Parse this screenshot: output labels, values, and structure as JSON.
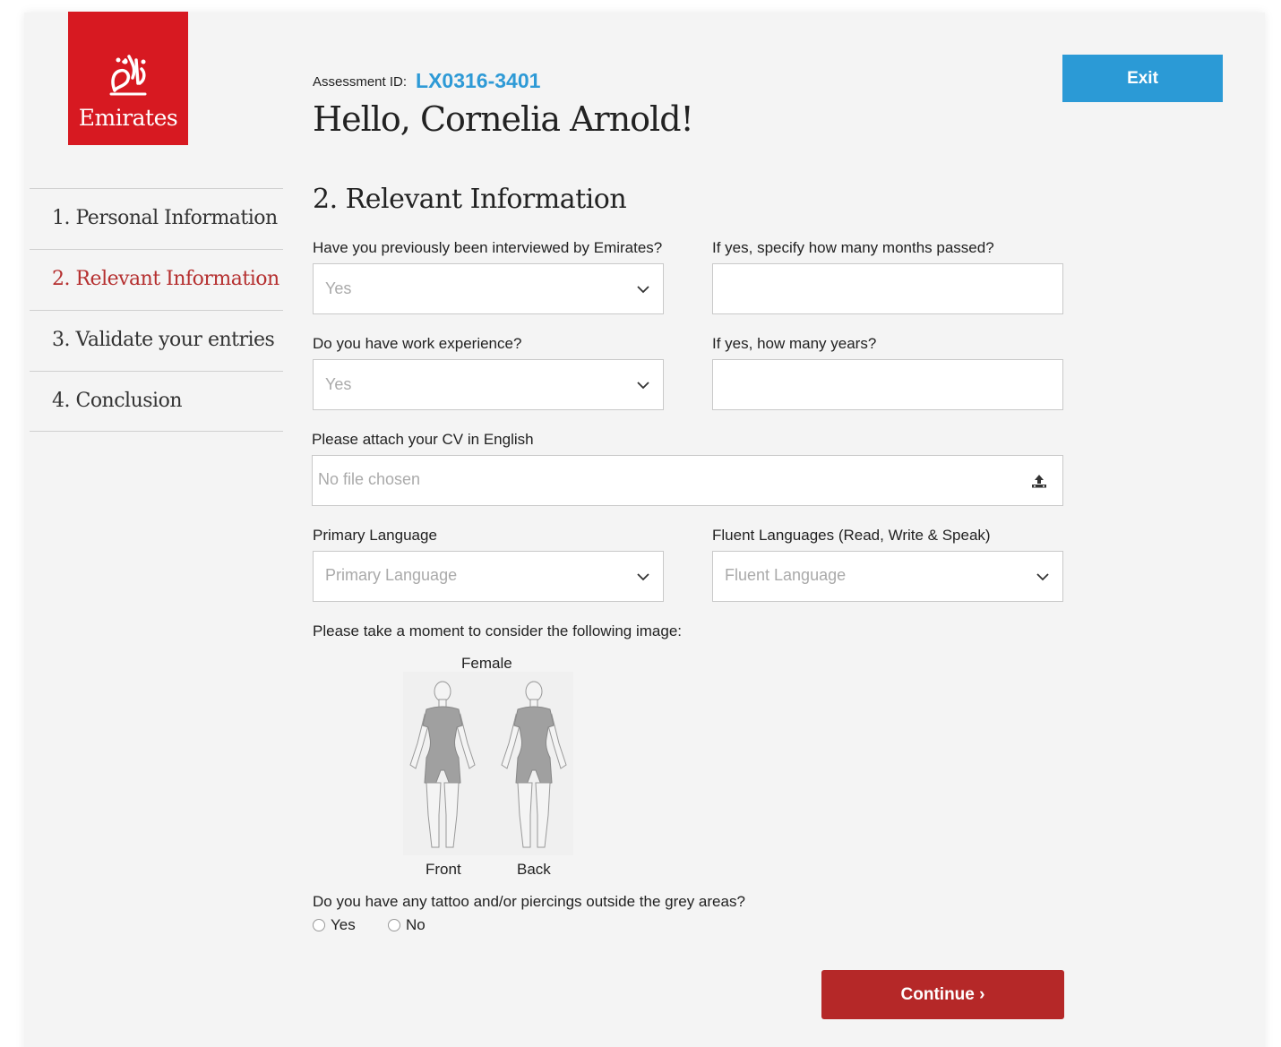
{
  "brand": {
    "wordmark": "Emirates",
    "red": "#d71921"
  },
  "header": {
    "assessment_label": "Assessment ID:",
    "assessment_id": "LX0316-3401",
    "greeting": "Hello, Cornelia Arnold!",
    "exit_label": "Exit"
  },
  "steps": [
    {
      "label": "1. Personal Information",
      "active": false
    },
    {
      "label": "2. Relevant Information",
      "active": true
    },
    {
      "label": "3. Validate your entries",
      "active": false
    },
    {
      "label": "4. Conclusion",
      "active": false
    }
  ],
  "form": {
    "title": "2. Relevant Information",
    "interviewed": {
      "label": "Have you previously been interviewed by Emirates?",
      "value": "Yes"
    },
    "months_passed": {
      "label": "If yes, specify how many months passed?",
      "value": ""
    },
    "work_experience": {
      "label": "Do you have work experience?",
      "value": "Yes"
    },
    "years": {
      "label": "If yes, how many years?",
      "value": ""
    },
    "cv": {
      "label": "Please attach your CV in English",
      "value": "No file chosen"
    },
    "primary_language": {
      "label": "Primary Language",
      "placeholder": "Primary Language"
    },
    "fluent_languages": {
      "label": "Fluent Languages (Read, Write & Speak)",
      "placeholder": "Fluent Language"
    },
    "image_prompt": "Please take a moment to consider the following image:",
    "figure": {
      "title": "Female",
      "front": "Front",
      "back": "Back"
    },
    "tattoo": {
      "question": "Do you have any tattoo and/or piercings outside the grey areas?",
      "options": [
        "Yes",
        "No"
      ]
    },
    "continue_label": "Continue ›"
  },
  "colors": {
    "accent_blue": "#2b9ad6",
    "accent_red": "#b52828",
    "active_step": "#b52f2f"
  },
  "icons": {
    "dropdown": "chevron-down-icon",
    "upload": "upload-icon"
  }
}
